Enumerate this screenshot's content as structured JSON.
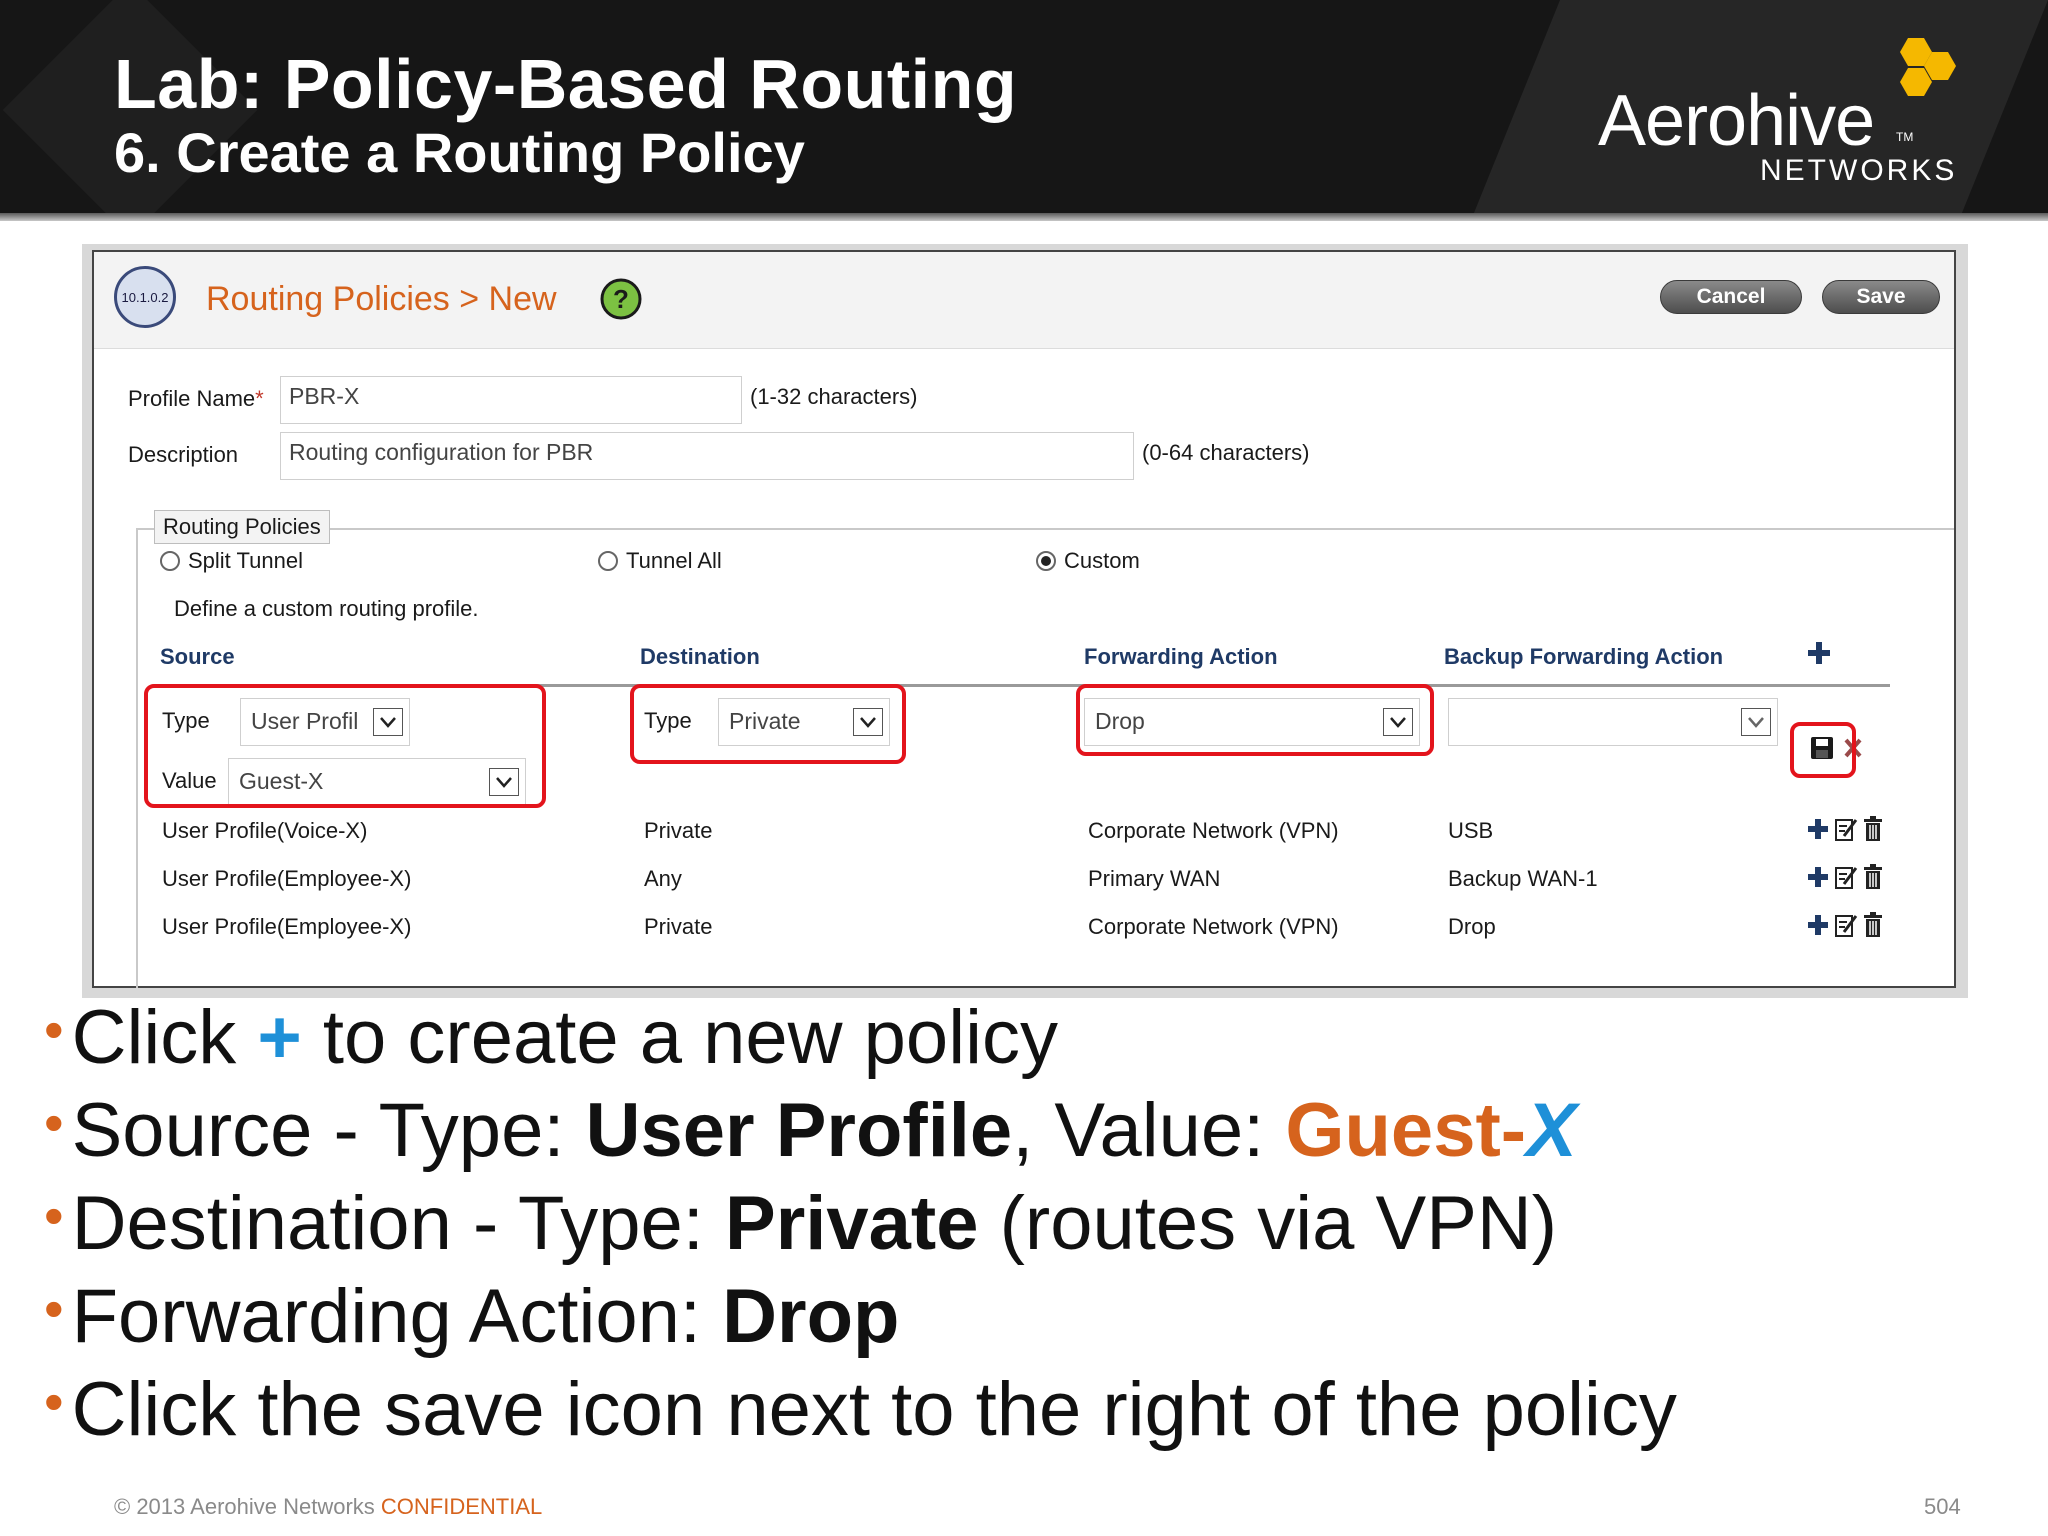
{
  "slide": {
    "title": "Lab: Policy-Based Routing",
    "subtitle": "6. Create a Routing Policy",
    "logo": {
      "word": "Aerohive",
      "tm": "TM",
      "sub": "NETWORKS",
      "hex_color": "#f5b800"
    },
    "footer_copyright": "© 2013 Aerohive Networks",
    "footer_confidential": "CONFIDENTIAL",
    "page_number": "504"
  },
  "app": {
    "ip_badge": "10.1.0.2",
    "breadcrumb": "Routing Policies > New",
    "cancel_label": "Cancel",
    "save_label": "Save",
    "profile_name_label": "Profile Name",
    "required_mark": "*",
    "profile_name_value": "PBR-X",
    "profile_name_hint": "(1-32 characters)",
    "description_label": "Description",
    "description_value": "Routing configuration for PBR",
    "description_hint": "(0-64 characters)",
    "group_legend": "Routing Policies",
    "radio_split": "Split Tunnel",
    "radio_tunnel": "Tunnel All",
    "radio_custom": "Custom",
    "selected_radio": "Custom",
    "define_text": "Define a custom routing profile.",
    "col_source": "Source",
    "col_destination": "Destination",
    "col_forwarding": "Forwarding Action",
    "col_backup": "Backup Forwarding Action",
    "new_row": {
      "type_label": "Type",
      "value_label": "Value",
      "source_type": "User Profil",
      "source_value": "Guest-X",
      "dest_type_label": "Type",
      "dest_type": "Private",
      "forwarding": "Drop",
      "backup": ""
    },
    "rows": [
      {
        "source": "User Profile(Voice-X)",
        "destination": "Private",
        "forwarding": "Corporate Network (VPN)",
        "backup": "USB"
      },
      {
        "source": "User Profile(Employee-X)",
        "destination": "Any",
        "forwarding": "Primary WAN",
        "backup": "Backup WAN-1"
      },
      {
        "source": "User Profile(Employee-X)",
        "destination": "Private",
        "forwarding": "Corporate Network (VPN)",
        "backup": "Drop"
      }
    ],
    "colors": {
      "accent_orange": "#d6631d",
      "header_blue": "#1f3a66",
      "highlight_red": "#e3141c",
      "plus_blue": "#1e90d8"
    }
  },
  "bullets": [
    {
      "a": "Click ",
      "plus": "+",
      "b": " to create a new policy"
    },
    {
      "a": "Source - Type: ",
      "bold": "User Profile",
      "b": ", Value: ",
      "orange": "Guest-",
      "x": "X"
    },
    {
      "a": "Destination - Type: ",
      "bold": "Private",
      "b": " (routes via VPN)"
    },
    {
      "a": "Forwarding Action: ",
      "bold": "Drop"
    },
    {
      "a": "Click the save icon next to the right of the policy"
    }
  ]
}
